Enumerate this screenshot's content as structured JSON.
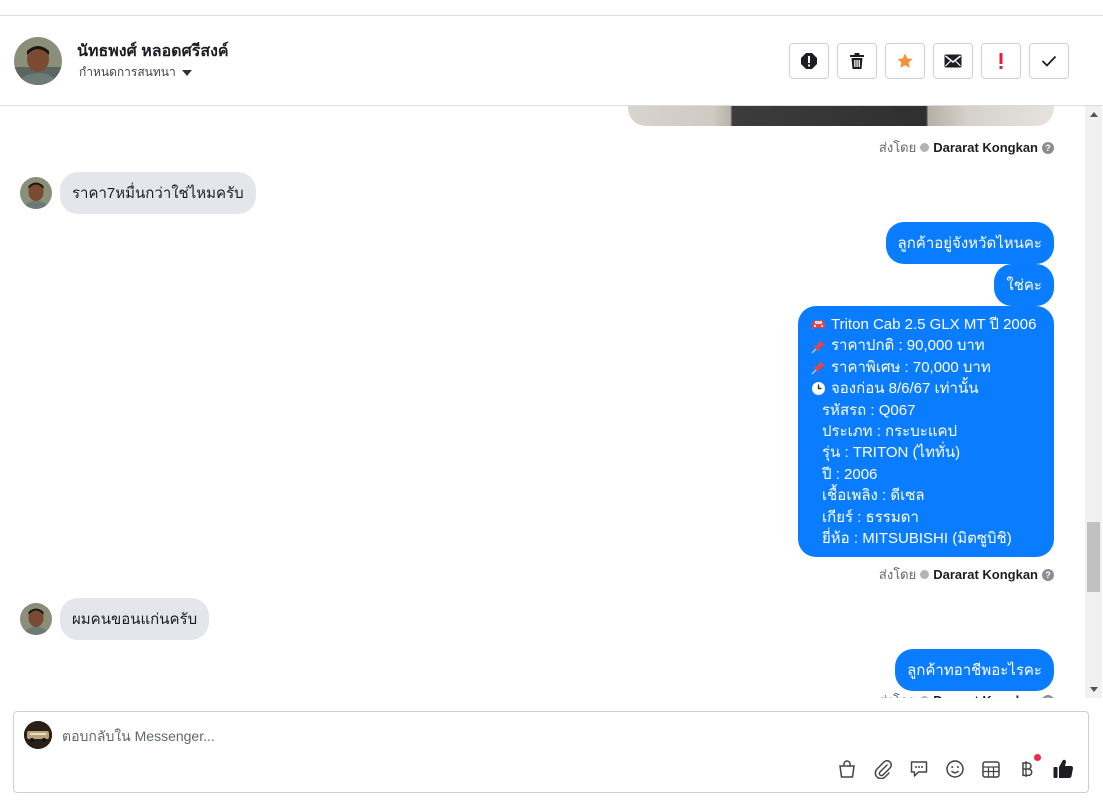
{
  "header": {
    "contact_name": "นัทธพงศ์ หลอดศรีสงค์",
    "conversation_setting": "กำหนดการสนทนา"
  },
  "actions": [
    {
      "name": "spam-button",
      "icon": "alert-circle-icon"
    },
    {
      "name": "delete-button",
      "icon": "trash-icon"
    },
    {
      "name": "star-button",
      "icon": "star-icon",
      "color": "#f7923b"
    },
    {
      "name": "mark-unread-button",
      "icon": "envelope-icon"
    },
    {
      "name": "follow-up-button",
      "icon": "exclamation-icon",
      "color": "#e41e3f"
    },
    {
      "name": "mark-done-button",
      "icon": "check-icon"
    }
  ],
  "thread": {
    "sent_by_label": "ส่งโดย",
    "agent_name": "Dararat Kongkan",
    "help_icon": "?",
    "messages": {
      "in_1": "ราคา7หมื่นกว่าใช่ไหมครับ",
      "out_1": "ลูกค้าอยู่จังหวัดไหนคะ",
      "out_2": "ใช่คะ",
      "in_2": "ผมคนขอนแก่นครับ",
      "out_3": "ลูกค้าทอาชีพอะไรคะ"
    },
    "card": {
      "line1": "Triton Cab 2.5 GLX MT ปี 2006",
      "line2": "ราคาปกติ : 90,000 บาท",
      "line3": "ราคาพิเศษ : 70,000 บาท",
      "line4": "จองก่อน 8/6/67 เท่านั้น",
      "line5": "รหัสรถ : Q067",
      "line6": "ประเภท : กระบะแคป",
      "line7": "รุ่น : TRITON (ไททั่น)",
      "line8": "ปี : 2006",
      "line9": "เชื้อเพลิง : ดีเซล",
      "line10": "เกียร์ : ธรรมดา",
      "line11": "ยี่ห้อ : MITSUBISHI (มิตซูบิชิ)"
    }
  },
  "composer": {
    "placeholder": "ตอบกลับใน Messenger...",
    "value": ""
  },
  "colors": {
    "outgoing_bubble": "#0a7cff",
    "incoming_bubble": "#e4e6eb",
    "star": "#f7923b",
    "alert": "#e41e3f"
  }
}
